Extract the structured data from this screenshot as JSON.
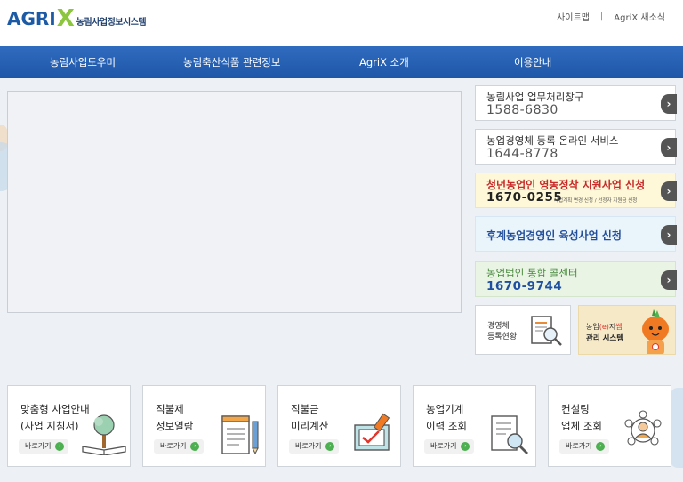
{
  "header": {
    "logo_brand": "AGRI",
    "logo_x": "X",
    "logo_subtitle": "농림사업정보시스템",
    "links": [
      "사이트맵",
      "AgriX 새소식"
    ],
    "separator": "|"
  },
  "nav": {
    "items": [
      "농림사업도우미",
      "농림축산식품 관련정보",
      "AgriX 소개",
      "이용안내"
    ]
  },
  "side": {
    "cards": [
      {
        "line1": "농림사업 업무처리창구",
        "line2": "1588-6830"
      },
      {
        "line1": "농업경영체 등록 온라인 서비스",
        "line2": "1644-8778"
      },
      {
        "line1": "청년농업인 영농정착 지원사업 신청",
        "line2": "1670-0255",
        "line3": "사업계획 변경 신청 / 선정자 지원금 신청"
      },
      {
        "line1": "후계농업경영인 육성사업 신청"
      },
      {
        "line1": "농업법인 통합 콜센터",
        "line2": "1670-9744"
      }
    ],
    "arrow": "›",
    "status_box": {
      "line1": "경영체",
      "line2": "등록현황"
    },
    "ecard_box": {
      "line1_a": "농업",
      "line1_b": "(e)",
      "line1_c": "지",
      "line1_d": "쌤",
      "line2": "관리 시스템"
    }
  },
  "bottom": {
    "goto_label": "바로가기",
    "goto_icon": "›",
    "cards": [
      {
        "line1": "맞춤형 사업안내",
        "line2": "(사업 지침서)"
      },
      {
        "line1": "직불제",
        "line2": "정보열람"
      },
      {
        "line1": "직불금",
        "line2": "미리계산"
      },
      {
        "line1": "농업기계",
        "line2": "이력 조회"
      },
      {
        "line1": "컨설팅",
        "line2": "업체 조회"
      }
    ]
  },
  "colors": {
    "nav": "#2a63b4",
    "accent_green": "#8cc63f",
    "brand_blue": "#1c5aa6",
    "highlight_red": "#c72b2b"
  }
}
